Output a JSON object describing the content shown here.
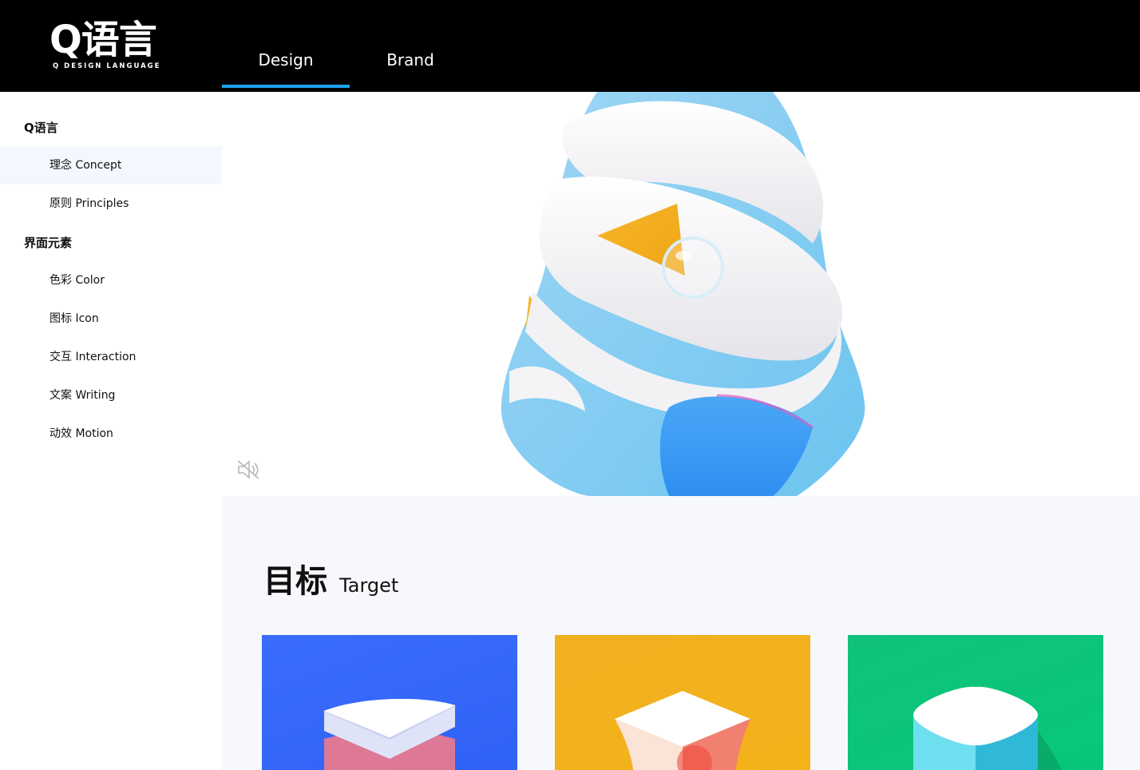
{
  "header": {
    "logo_main": "Q语言",
    "logo_sub": "Q DESIGN LANGUAGE",
    "tabs": [
      {
        "label": "Design",
        "active": true
      },
      {
        "label": "Brand",
        "active": false
      }
    ],
    "accent_color": "#1ea0f0"
  },
  "sidebar": {
    "groups": [
      {
        "title": "Q语言",
        "items": [
          {
            "label": "理念 Concept",
            "active": true
          },
          {
            "label": "原则 Principles",
            "active": false
          }
        ]
      },
      {
        "title": "界面元素",
        "items": [
          {
            "label": "色彩 Color",
            "active": false
          },
          {
            "label": "图标 Icon",
            "active": false
          },
          {
            "label": "交互 Interaction",
            "active": false
          },
          {
            "label": "文案 Writing",
            "active": false
          },
          {
            "label": "动效 Motion",
            "active": false
          }
        ]
      }
    ]
  },
  "hero": {
    "mute_icon": "speaker-muted-icon"
  },
  "target": {
    "title_cn": "目标",
    "title_en": "Target",
    "cards": [
      {
        "color": "#3a6dfc"
      },
      {
        "color": "#f4b31a"
      },
      {
        "color": "#06c77a"
      }
    ]
  }
}
